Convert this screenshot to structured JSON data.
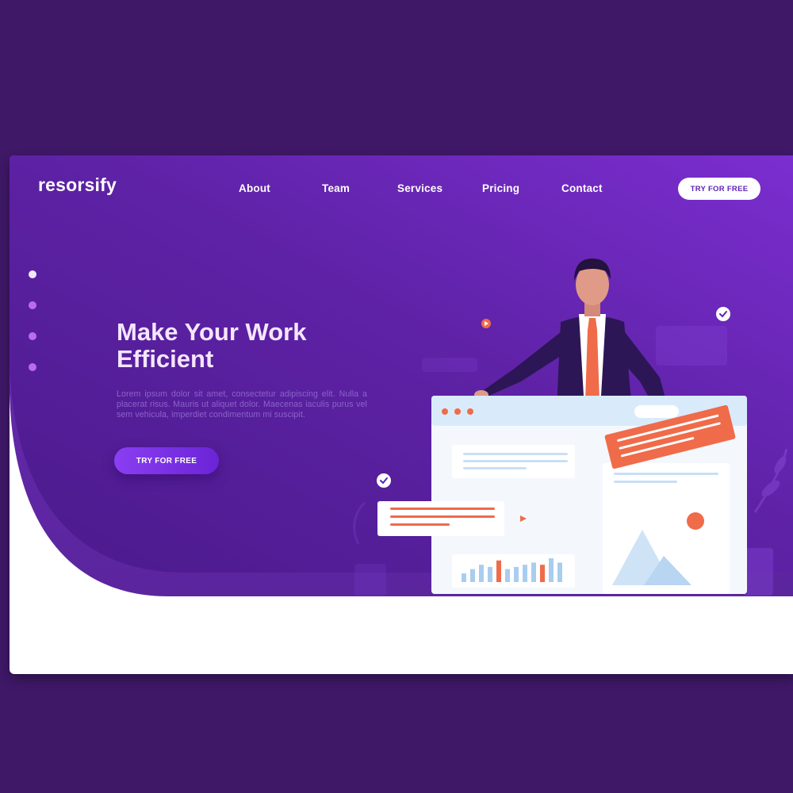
{
  "brand": {
    "name": "resorsify"
  },
  "nav": {
    "items": [
      {
        "label": "About"
      },
      {
        "label": "Team"
      },
      {
        "label": "Services"
      },
      {
        "label": "Pricing"
      },
      {
        "label": "Contact"
      }
    ],
    "cta_label": "TRY FOR FREE"
  },
  "hero": {
    "headline_line1": "Make Your Work",
    "headline_line2": "Efficient",
    "body": "Lorem ipsum dolor sit amet, consectetur adipiscing elit. Nulla a placerat risus. Mauris ut aliquet dolor. Maecenas iaculis purus vel sem vehicula, imperdiet condimentum mi suscipit.",
    "cta_label": "TRY FOR FREE",
    "slide_dots": {
      "count": 4,
      "active_index": 0
    }
  },
  "illustration": {
    "icons": [
      "check-circle-icon",
      "play-icon",
      "image-placeholder-icon"
    ],
    "bar_chart_values": [
      4,
      6,
      8,
      7,
      10,
      6,
      7,
      8,
      9,
      8,
      11,
      9
    ],
    "bar_chart_highlight": [
      4,
      9
    ]
  },
  "colors": {
    "page_bg": "#3f1868",
    "hero_gradient_start": "#5a1f9e",
    "hero_gradient_end": "#7d2fd0",
    "accent_orange": "#ef6b4a",
    "cta_purple": "#7a30e6",
    "text_light": "#f4e6ff"
  }
}
